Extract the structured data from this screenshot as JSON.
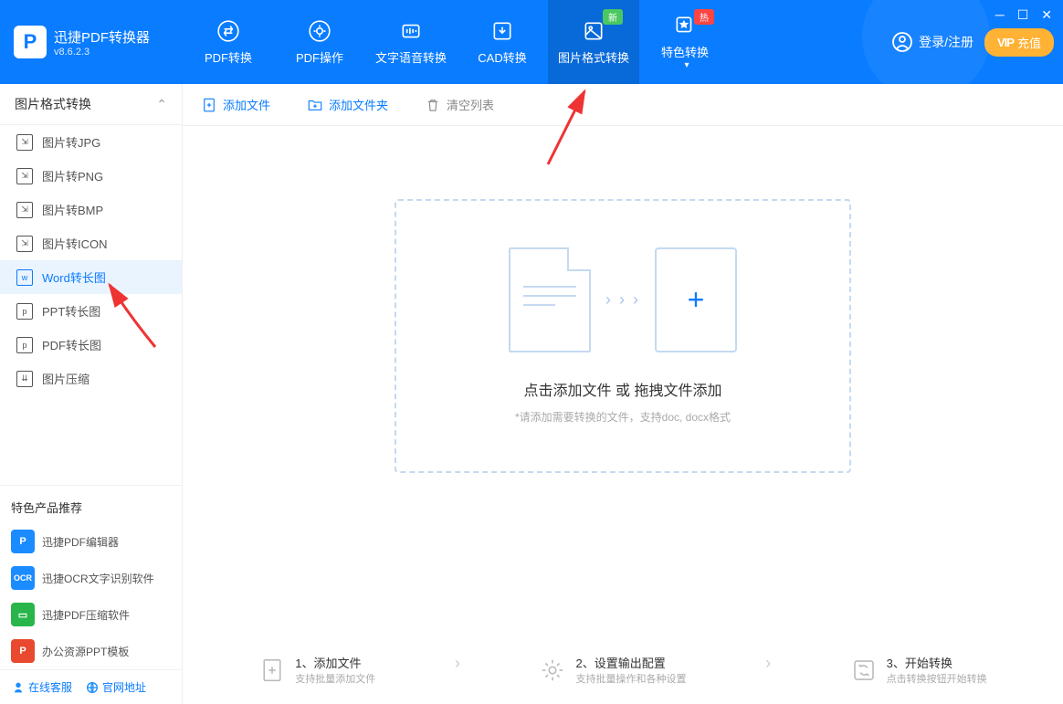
{
  "app": {
    "name": "迅捷PDF转换器",
    "version": "v8.6.2.3"
  },
  "nav": {
    "tabs": [
      {
        "label": "PDF转换"
      },
      {
        "label": "PDF操作"
      },
      {
        "label": "文字语音转换"
      },
      {
        "label": "CAD转换"
      },
      {
        "label": "图片格式转换"
      },
      {
        "label": "特色转换"
      }
    ],
    "badge_new": "新",
    "badge_hot": "热",
    "login": "登录/注册",
    "vip_prefix": "VIP",
    "vip_action": "充值"
  },
  "sidebar": {
    "section_title": "图片格式转换",
    "items": [
      {
        "label": "图片转JPG"
      },
      {
        "label": "图片转PNG"
      },
      {
        "label": "图片转BMP"
      },
      {
        "label": "图片转ICON"
      },
      {
        "label": "Word转长图"
      },
      {
        "label": "PPT转长图"
      },
      {
        "label": "PDF转长图"
      },
      {
        "label": "图片压缩"
      }
    ],
    "rec_title": "特色产品推荐",
    "recs": [
      {
        "label": "迅捷PDF编辑器"
      },
      {
        "label": "迅捷OCR文字识别软件"
      },
      {
        "label": "迅捷PDF压缩软件"
      },
      {
        "label": "办公资源PPT模板"
      }
    ],
    "footer": {
      "service": "在线客服",
      "site": "官网地址"
    }
  },
  "toolbar": {
    "add_file": "添加文件",
    "add_folder": "添加文件夹",
    "clear": "清空列表"
  },
  "dropzone": {
    "title": "点击添加文件 或 拖拽文件添加",
    "subtitle": "*请添加需要转换的文件，支持doc, docx格式"
  },
  "steps": [
    {
      "title": "1、添加文件",
      "sub": "支持批量添加文件"
    },
    {
      "title": "2、设置输出配置",
      "sub": "支持批量操作和各种设置"
    },
    {
      "title": "3、开始转换",
      "sub": "点击转换按钮开始转换"
    }
  ]
}
